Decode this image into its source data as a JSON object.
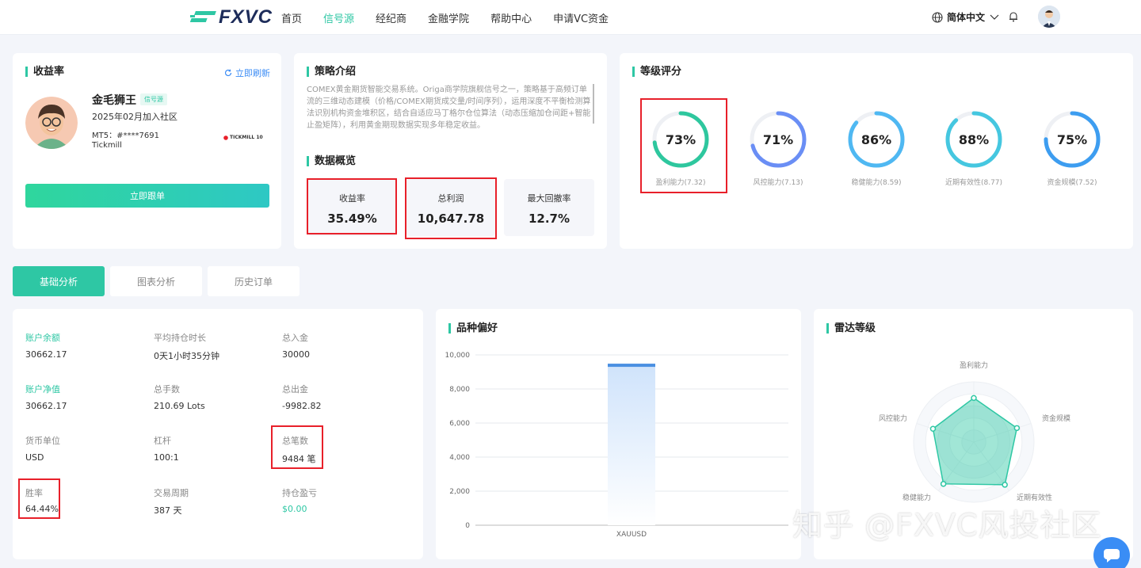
{
  "header": {
    "logo": "FXVC",
    "nav": [
      "首页",
      "信号源",
      "经纪商",
      "金融学院",
      "帮助中心",
      "申请VC资金"
    ],
    "active_nav": "信号源",
    "language": "简体中文"
  },
  "profile": {
    "title": "收益率",
    "refresh": "立即刷新",
    "name": "金毛狮王",
    "tag": "信号源",
    "joined": "2025年02月加入社区",
    "mt5": "MT5：#****7691",
    "broker": "Tickmill",
    "broker_logo": "TICKMILL 10",
    "follow_button": "立即跟单"
  },
  "strategy": {
    "title": "策略介绍",
    "description": "COMEX黄金期货智能交易系统。Origa商学院旗舰信号之一，策略基于高频订单流的三维动态建模（价格/COMEX期货成交量/时间序列），运用深度不平衡检测算法识别机构资金堆积区，结合自适应马丁格尔仓位算法（动态压缩加仓间距+智能止盈矩阵），利用黄金期现数据实现多年稳定收益。",
    "overview_title": "数据概览",
    "stats": [
      {
        "label": "收益率",
        "value": "35.49%"
      },
      {
        "label": "总利润",
        "value": "10,647.78"
      },
      {
        "label": "最大回撤率",
        "value": "12.7%"
      }
    ]
  },
  "rating": {
    "title": "等级评分",
    "items": [
      {
        "value": "73%",
        "label": "盈利能力(7.32)",
        "pct": 0.73,
        "color": "#2ec79e"
      },
      {
        "value": "71%",
        "label": "风控能力(7.13)",
        "pct": 0.71,
        "color": "#6a8ef5"
      },
      {
        "value": "86%",
        "label": "稳健能力(8.59)",
        "pct": 0.86,
        "color": "#4fb8f2"
      },
      {
        "value": "88%",
        "label": "近期有效性(8.77)",
        "pct": 0.88,
        "color": "#45c7e0"
      },
      {
        "value": "75%",
        "label": "资金规模(7.52)",
        "pct": 0.75,
        "color": "#3d9df0"
      }
    ]
  },
  "tabs": [
    "基础分析",
    "图表分析",
    "历史订单"
  ],
  "basics": {
    "account_balance_label": "账户余额",
    "account_balance": "30662.17",
    "avg_hold_label": "平均持仓时长",
    "avg_hold": "0天1小时35分钟",
    "deposit_label": "总入金",
    "deposit": "30000",
    "equity_label": "账户净值",
    "equity": "30662.17",
    "lots_label": "总手数",
    "lots": "210.69 Lots",
    "withdraw_label": "总出金",
    "withdraw": "-9982.82",
    "currency_label": "货币单位",
    "currency": "USD",
    "leverage_label": "杠杆",
    "leverage": "100:1",
    "trades_label": "总笔数",
    "trades": "9484 笔",
    "winrate_label": "胜率",
    "winrate": "64.44%",
    "period_label": "交易周期",
    "period": "387 天",
    "floating_label": "持仓盈亏",
    "floating": "$0.00"
  },
  "preference": {
    "title": "品种偏好"
  },
  "chart_data": {
    "type": "bar",
    "categories": [
      "XAUUSD"
    ],
    "values": [
      9484
    ],
    "ylim": [
      0,
      10000
    ],
    "yticks": [
      "0",
      "2,000",
      "4,000",
      "6,000",
      "8,000",
      "10,000"
    ],
    "grid": true
  },
  "radar": {
    "title": "雷达等级",
    "axes": [
      "盈利能力",
      "资金规模",
      "近期有效性",
      "稳健能力",
      "风控能力"
    ],
    "values": [
      7.32,
      7.52,
      8.77,
      8.59,
      7.13
    ],
    "max": 10
  },
  "watermark": "知乎 @FXVC风投社区",
  "colors": {
    "accent": "#2ec7a4",
    "highlight": "#e8202a",
    "bar": "#4a90e2"
  }
}
